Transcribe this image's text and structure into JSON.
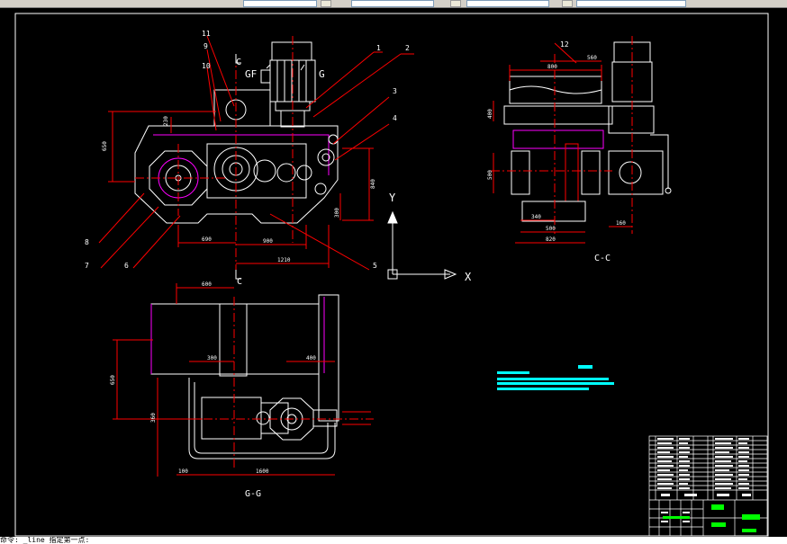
{
  "view_labels": {
    "section_top": "C",
    "section_bottom": "C",
    "view_gf": "GF",
    "view_g": "G",
    "side_view": "C-C",
    "plan_view": "G-G"
  },
  "axes": {
    "x": "X",
    "y": "Y"
  },
  "balloons": [
    "1",
    "2",
    "3",
    "4",
    "5",
    "6",
    "7",
    "8",
    "9",
    "10",
    "11",
    "12"
  ],
  "dims": {
    "main_height": "650",
    "main_h2": "230",
    "main_right": "840",
    "main_right2": "300",
    "main_bottom1": "690",
    "main_bottom2": "900",
    "main_bottom3": "1210",
    "side_top1": "800",
    "side_top2": "560",
    "side_left1": "400",
    "side_left2": "500",
    "side_b1": "340",
    "side_b2": "500",
    "side_b3": "820",
    "side_right": "160",
    "plan_top": "600",
    "plan_left1": "650",
    "plan_left2": "360",
    "plan_mid1": "300",
    "plan_mid2": "400",
    "plan_b1": "100",
    "plan_b2": "1600"
  },
  "command_line": "命令: _line  指定第一点:",
  "colors": {
    "background": "#000000",
    "frame": "#ffffff",
    "dimension": "#ff0000",
    "part": "#ffffff",
    "centerline": "#ff0000",
    "hidden": "#ff00ff",
    "text_block": "#00ffff",
    "title_fill": "#00ff00"
  }
}
